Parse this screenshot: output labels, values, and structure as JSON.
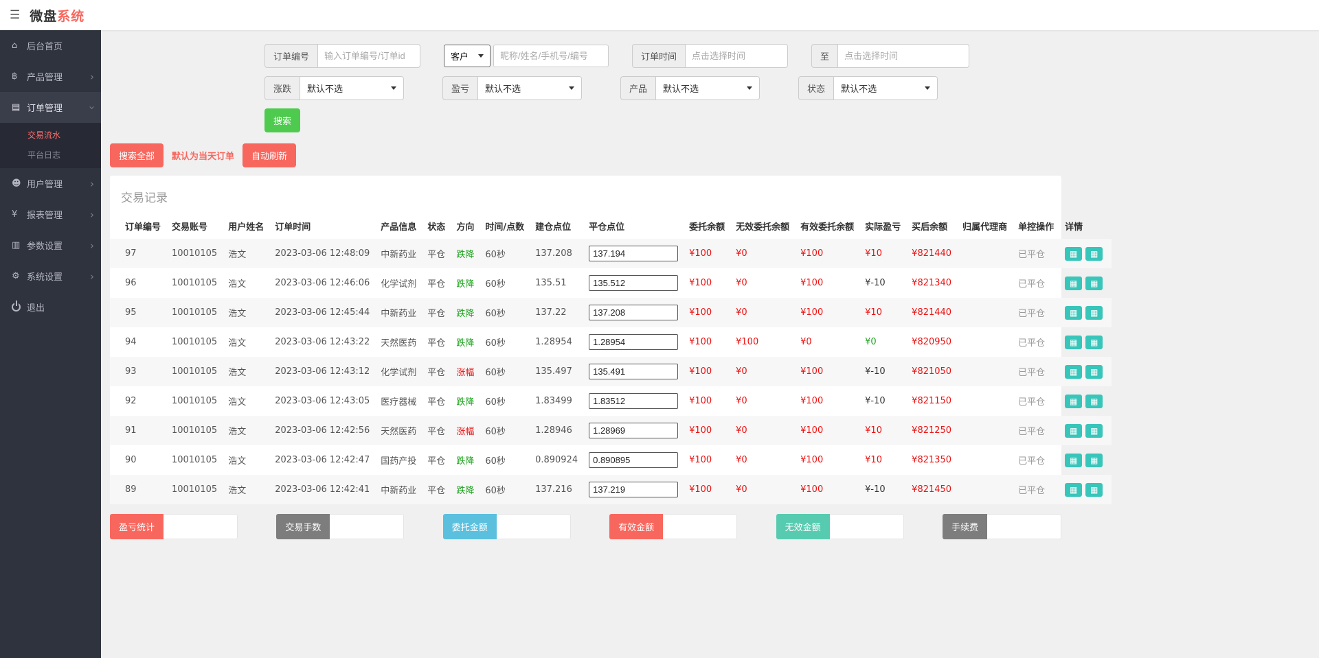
{
  "colors": {
    "accent": "#f8675e",
    "money-red": "#ee1111",
    "green-btn": "#4ecb4e",
    "green-text": "#1fa31f",
    "teal": "#38c5ba",
    "blue": "#5bc0de",
    "mint": "#57cbb0",
    "gray-btn": "#7d7d7d",
    "sidebar-bg": "#2f333e"
  },
  "header": {
    "menu_icon": "hamburger-icon",
    "brand_black": "微盘",
    "brand_red": "系统"
  },
  "sidebar": {
    "items": [
      {
        "key": "home",
        "icon": "dashboard-icon",
        "label": "后台首页",
        "arrow": false
      },
      {
        "key": "products",
        "icon": "bitcoin-icon",
        "label": "产品管理",
        "arrow": true
      },
      {
        "key": "orders",
        "icon": "order-icon",
        "label": "订单管理",
        "arrow": true,
        "active": true,
        "children": [
          {
            "key": "trade-flow",
            "label": "交易流水",
            "active": true
          },
          {
            "key": "platform-log",
            "label": "平台日志",
            "active": false
          }
        ]
      },
      {
        "key": "users",
        "icon": "user-icon",
        "label": "用户管理",
        "arrow": true
      },
      {
        "key": "reports",
        "icon": "yen-icon",
        "label": "报表管理",
        "arrow": true
      },
      {
        "key": "params",
        "icon": "params-icon",
        "label": "参数设置",
        "arrow": true
      },
      {
        "key": "system",
        "icon": "gear-icon",
        "label": "系统设置",
        "arrow": true
      },
      {
        "key": "logout",
        "icon": "power-icon",
        "label": "退出",
        "arrow": false
      }
    ]
  },
  "filters": {
    "order_no_label": "订单编号",
    "order_no_placeholder": "输入订单编号/订单id",
    "customer_select_value": "客户",
    "customer_placeholder": "昵称/姓名/手机号/编号",
    "time_label": "订单时间",
    "time_from_placeholder": "点击选择时间",
    "to_label": "至",
    "time_to_placeholder": "点击选择时间",
    "updown_label": "涨跌",
    "updown_value": "默认不选",
    "pnl_label": "盈亏",
    "pnl_value": "默认不选",
    "product_label": "产品",
    "product_value": "默认不选",
    "status_label": "状态",
    "status_value": "默认不选",
    "search_button": "搜索"
  },
  "actions": {
    "search_all": "搜索全部",
    "note": "默认为当天订单",
    "auto_refresh": "自动刷新"
  },
  "table": {
    "title": "交易记录",
    "columns": [
      "订单编号",
      "交易账号",
      "用户姓名",
      "订单时间",
      "产品信息",
      "状态",
      "方向",
      "时间/点数",
      "建仓点位",
      "平仓点位",
      "委托余额",
      "无效委托余额",
      "有效委托余额",
      "实际盈亏",
      "买后余额",
      "归属代理商",
      "单控操作",
      "详情"
    ],
    "rows": [
      {
        "order_id": "97",
        "account": "10010105",
        "name": "浩文",
        "time": "2023-03-06 12:48:09",
        "product": "中新药业",
        "status": "平仓",
        "direction": "跌降",
        "direction_color": "green",
        "duration": "60秒",
        "open_point": "137.208",
        "close_point": "137.194",
        "entrust": "¥100",
        "invalid_entrust": "¥0",
        "valid_entrust": "¥100",
        "pnl": "¥10",
        "pnl_color": "red",
        "balance": "¥821440",
        "agent": "",
        "control": "已平仓"
      },
      {
        "order_id": "96",
        "account": "10010105",
        "name": "浩文",
        "time": "2023-03-06 12:46:06",
        "product": "化学试剂",
        "status": "平仓",
        "direction": "跌降",
        "direction_color": "green",
        "duration": "60秒",
        "open_point": "135.51",
        "close_point": "135.512",
        "entrust": "¥100",
        "invalid_entrust": "¥0",
        "valid_entrust": "¥100",
        "pnl": "¥-10",
        "pnl_color": "dark",
        "balance": "¥821340",
        "agent": "",
        "control": "已平仓"
      },
      {
        "order_id": "95",
        "account": "10010105",
        "name": "浩文",
        "time": "2023-03-06 12:45:44",
        "product": "中新药业",
        "status": "平仓",
        "direction": "跌降",
        "direction_color": "green",
        "duration": "60秒",
        "open_point": "137.22",
        "close_point": "137.208",
        "entrust": "¥100",
        "invalid_entrust": "¥0",
        "valid_entrust": "¥100",
        "pnl": "¥10",
        "pnl_color": "red",
        "balance": "¥821440",
        "agent": "",
        "control": "已平仓"
      },
      {
        "order_id": "94",
        "account": "10010105",
        "name": "浩文",
        "time": "2023-03-06 12:43:22",
        "product": "天然医药",
        "status": "平仓",
        "direction": "跌降",
        "direction_color": "green",
        "duration": "60秒",
        "open_point": "1.28954",
        "close_point": "1.28954",
        "entrust": "¥100",
        "invalid_entrust": "¥100",
        "valid_entrust": "¥0",
        "pnl": "¥0",
        "pnl_color": "green",
        "balance": "¥820950",
        "agent": "",
        "control": "已平仓"
      },
      {
        "order_id": "93",
        "account": "10010105",
        "name": "浩文",
        "time": "2023-03-06 12:43:12",
        "product": "化学试剂",
        "status": "平仓",
        "direction": "涨幅",
        "direction_color": "red",
        "duration": "60秒",
        "open_point": "135.497",
        "close_point": "135.491",
        "entrust": "¥100",
        "invalid_entrust": "¥0",
        "valid_entrust": "¥100",
        "pnl": "¥-10",
        "pnl_color": "dark",
        "balance": "¥821050",
        "agent": "",
        "control": "已平仓"
      },
      {
        "order_id": "92",
        "account": "10010105",
        "name": "浩文",
        "time": "2023-03-06 12:43:05",
        "product": "医疗器械",
        "status": "平仓",
        "direction": "跌降",
        "direction_color": "green",
        "duration": "60秒",
        "open_point": "1.83499",
        "close_point": "1.83512",
        "entrust": "¥100",
        "invalid_entrust": "¥0",
        "valid_entrust": "¥100",
        "pnl": "¥-10",
        "pnl_color": "dark",
        "balance": "¥821150",
        "agent": "",
        "control": "已平仓"
      },
      {
        "order_id": "91",
        "account": "10010105",
        "name": "浩文",
        "time": "2023-03-06 12:42:56",
        "product": "天然医药",
        "status": "平仓",
        "direction": "涨幅",
        "direction_color": "red",
        "duration": "60秒",
        "open_point": "1.28946",
        "close_point": "1.28969",
        "entrust": "¥100",
        "invalid_entrust": "¥0",
        "valid_entrust": "¥100",
        "pnl": "¥10",
        "pnl_color": "red",
        "balance": "¥821250",
        "agent": "",
        "control": "已平仓"
      },
      {
        "order_id": "90",
        "account": "10010105",
        "name": "浩文",
        "time": "2023-03-06 12:42:47",
        "product": "国药产投",
        "status": "平仓",
        "direction": "跌降",
        "direction_color": "green",
        "duration": "60秒",
        "open_point": "0.890924",
        "close_point": "0.890895",
        "entrust": "¥100",
        "invalid_entrust": "¥0",
        "valid_entrust": "¥100",
        "pnl": "¥10",
        "pnl_color": "red",
        "balance": "¥821350",
        "agent": "",
        "control": "已平仓"
      },
      {
        "order_id": "89",
        "account": "10010105",
        "name": "浩文",
        "time": "2023-03-06 12:42:41",
        "product": "中新药业",
        "status": "平仓",
        "direction": "跌降",
        "direction_color": "green",
        "duration": "60秒",
        "open_point": "137.216",
        "close_point": "137.219",
        "entrust": "¥100",
        "invalid_entrust": "¥0",
        "valid_entrust": "¥100",
        "pnl": "¥-10",
        "pnl_color": "dark",
        "balance": "¥821450",
        "agent": "",
        "control": "已平仓"
      }
    ]
  },
  "summary": [
    {
      "key": "pnl-total",
      "label": "盈亏统计",
      "color": "red",
      "value": ""
    },
    {
      "key": "lots",
      "label": "交易手数",
      "color": "gray",
      "value": ""
    },
    {
      "key": "entrust-amount",
      "label": "委托金额",
      "color": "blue",
      "value": ""
    },
    {
      "key": "valid-amount",
      "label": "有效金额",
      "color": "red",
      "value": ""
    },
    {
      "key": "invalid-amount",
      "label": "无效金额",
      "color": "mint",
      "value": ""
    },
    {
      "key": "fee",
      "label": "手续费",
      "color": "gray",
      "value": ""
    }
  ]
}
